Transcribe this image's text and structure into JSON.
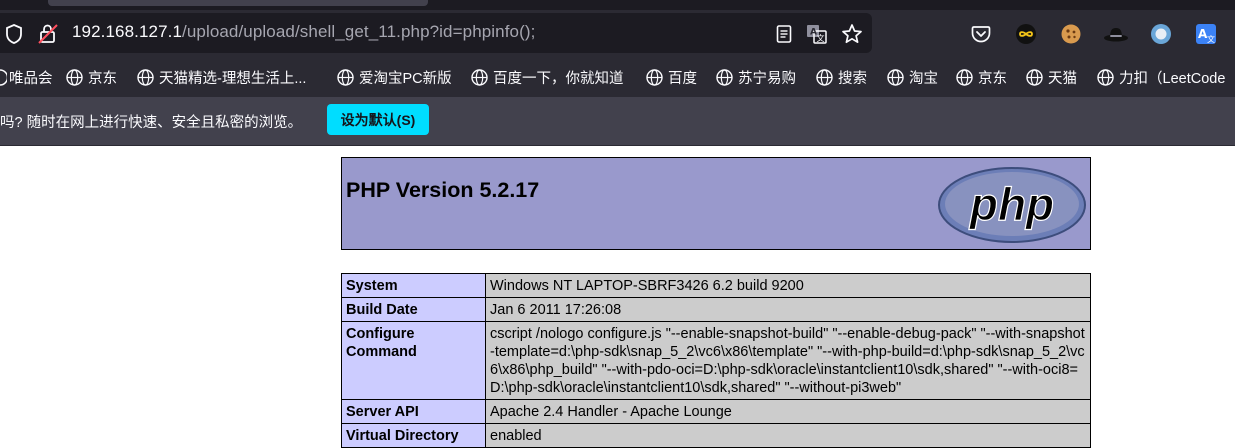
{
  "browser": {
    "url": {
      "host": "192.168.127.1",
      "path": "/upload/upload/shell_get_11.php?id=phpinfo();"
    },
    "toolbar_icons": [
      "pocket-icon",
      "infinity-extension-icon",
      "cookie-extension-icon",
      "hat-extension-icon",
      "circle-extension-icon",
      "translate-extension-icon"
    ],
    "bookmarks": [
      "唯品会",
      "京东",
      "天猫精选-理想生活上...",
      "爱淘宝PC新版",
      "百度一下，你就知道",
      "百度",
      "苏宁易购",
      "搜索",
      "淘宝",
      "京东",
      "天猫",
      "力扣（LeetCode"
    ],
    "notification": {
      "text": "吗? 随时在网上进行快速、安全且私密的浏览。",
      "button": "设为默认(S)"
    },
    "colors": {
      "chrome": "#2b2a33",
      "urlbar": "#1c1b22",
      "notification": "#42414d",
      "accent": "#00ddff"
    }
  },
  "php": {
    "title": "PHP Version 5.2.17",
    "logo_text": "php",
    "colors": {
      "header": "#9999cc",
      "key": "#ccccff",
      "value": "#cccccc"
    },
    "rows": [
      {
        "key": "System",
        "value": "Windows NT LAPTOP-SBRF3426 6.2 build 9200"
      },
      {
        "key": "Build Date",
        "value": "Jan 6 2011 17:26:08"
      },
      {
        "key": "Configure Command",
        "value": "cscript /nologo configure.js \"--enable-snapshot-build\" \"--enable-debug-pack\" \"--with-snapshot-template=d:\\php-sdk\\snap_5_2\\vc6\\x86\\template\" \"--with-php-build=d:\\php-sdk\\snap_5_2\\vc6\\x86\\php_build\" \"--with-pdo-oci=D:\\php-sdk\\oracle\\instantclient10\\sdk,shared\" \"--with-oci8=D:\\php-sdk\\oracle\\instantclient10\\sdk,shared\" \"--without-pi3web\""
      },
      {
        "key": "Server API",
        "value": "Apache 2.4 Handler - Apache Lounge"
      },
      {
        "key": "Virtual Directory",
        "value": "enabled"
      }
    ]
  }
}
